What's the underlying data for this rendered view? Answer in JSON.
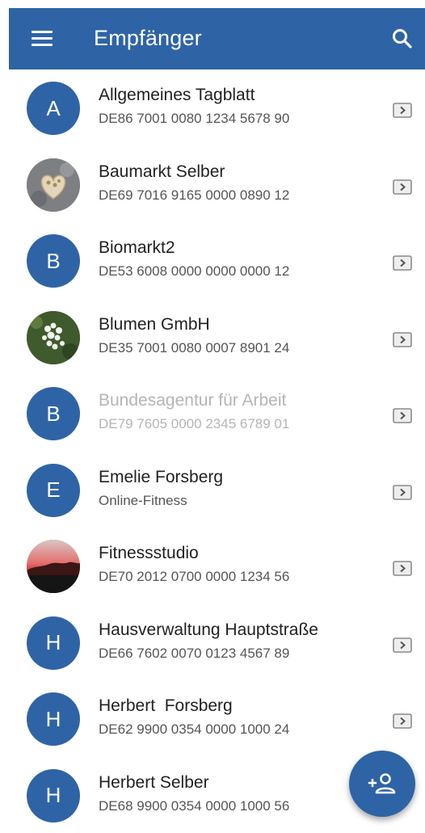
{
  "appbar": {
    "title": "Empfänger",
    "menu_icon": "hamburger-menu-icon",
    "search_icon": "search-icon"
  },
  "accent_color": "#2e64a5",
  "recipients": [
    {
      "initial": "A",
      "name": "Allgemeines Tagblatt",
      "sub": "DE86 7001 0080 1234 5678 90",
      "avatar": "initial"
    },
    {
      "initial": "",
      "name": "Baumarkt Selber",
      "sub": "DE69 7016 9165 0000 0890 12",
      "avatar": "photo-heart-stones"
    },
    {
      "initial": "B",
      "name": "Biomarkt2",
      "sub": "DE53 6008 0000 0000 0000 12",
      "avatar": "initial"
    },
    {
      "initial": "",
      "name": "Blumen GmbH",
      "sub": "DE35 7001 0080 0007 8901 24",
      "avatar": "photo-flowers"
    },
    {
      "initial": "B",
      "name": "Bundesagentur für Arbeit",
      "sub": "DE79 7605 0000 2345 6789 01",
      "avatar": "initial",
      "disabled": true
    },
    {
      "initial": "E",
      "name": "Emelie Forsberg",
      "sub": "Online-Fitness",
      "avatar": "initial"
    },
    {
      "initial": "",
      "name": "Fitnessstudio",
      "sub": "DE70 2012 0700 0000 1234 56",
      "avatar": "photo-sunset"
    },
    {
      "initial": "H",
      "name": "Hausverwaltung Hauptstraße",
      "sub": "DE66 7602 0070 0123 4567 89",
      "avatar": "initial"
    },
    {
      "initial": "H",
      "name": "Herbert  Forsberg",
      "sub": "DE62 9900 0354 0000 1000 24",
      "avatar": "initial"
    },
    {
      "initial": "H",
      "name": "Herbert Selber",
      "sub": "DE68 9900 0354 0000 1000 56",
      "avatar": "initial"
    }
  ],
  "fab": {
    "icon": "add-person-icon"
  }
}
